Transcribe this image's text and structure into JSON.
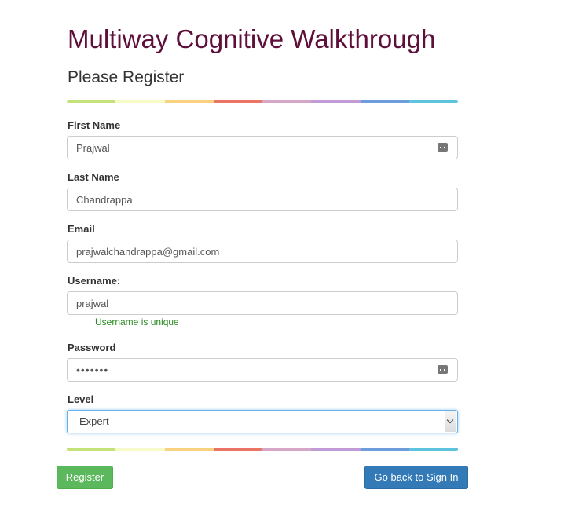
{
  "header": {
    "app_title": "Multiway Cognitive Walkthrough",
    "form_title": "Please Register"
  },
  "rainbow_colors": [
    "#c5e17a",
    "#f7fbc9",
    "#fad17f",
    "#ea7566",
    "#d6a6c6",
    "#c19bd6",
    "#6f9cdb",
    "#5ec3dd"
  ],
  "form": {
    "first_name": {
      "label": "First Name",
      "value": "Prajwal"
    },
    "last_name": {
      "label": "Last Name",
      "value": "Chandrappa"
    },
    "email": {
      "label": "Email",
      "value": "prajwalchandrappa@gmail.com"
    },
    "username": {
      "label": "Username:",
      "value": "prajwal",
      "hint": "Username is unique"
    },
    "password": {
      "label": "Password",
      "value": "•••••••"
    },
    "level": {
      "label": "Level",
      "selected": "Expert"
    }
  },
  "buttons": {
    "register": "Register",
    "sign_in": "Go back to Sign In"
  },
  "colors": {
    "title": "#5e0f3a",
    "hint": "#2a8a1f",
    "register_button": "#5cb85c",
    "sign_in_button": "#337ab7"
  }
}
